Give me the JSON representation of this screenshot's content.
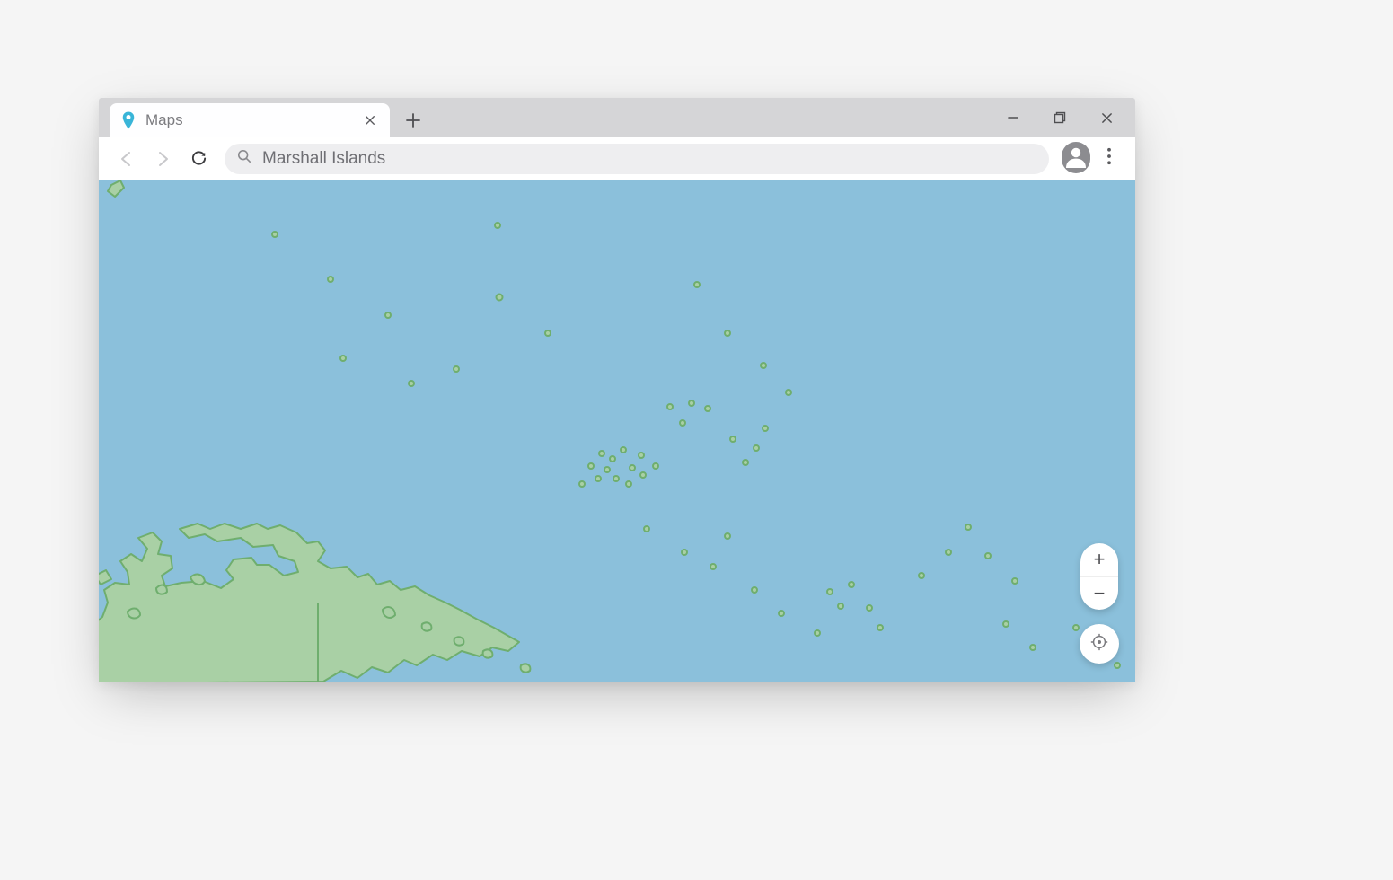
{
  "tab": {
    "title": "Maps"
  },
  "search": {
    "value": "Marshall Islands"
  },
  "zoom": {
    "in": "+",
    "out": "−"
  },
  "colors": {
    "water": "#8bc0db",
    "land_fill": "#a9d0a5",
    "land_stroke": "#6fae6e",
    "accent": "#39b5d8"
  }
}
